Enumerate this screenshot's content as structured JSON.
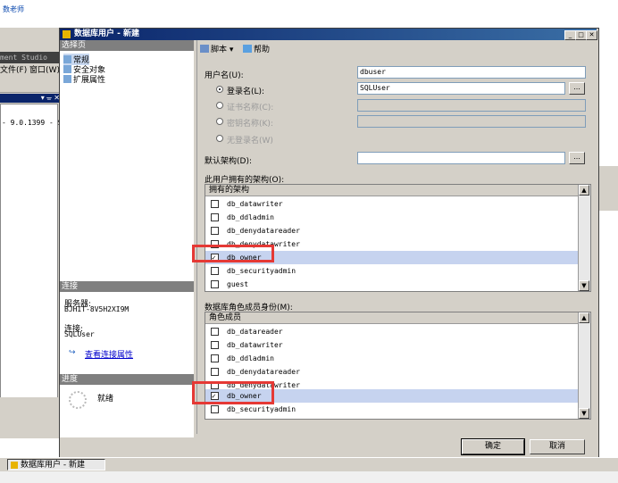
{
  "top": {
    "link": "数老师"
  },
  "bg": {
    "title": "ment Studio",
    "menu": "文件(F)  窗口(W)",
    "pane_btns": "▾ ᚚ ✕",
    "server_text": "- 9.0.1399 - S"
  },
  "dialog": {
    "title": "数据库用户 - 新建",
    "ctl_min": "_",
    "ctl_max": "□",
    "ctl_close": "✕"
  },
  "left": {
    "select_page_header": "选择页",
    "pages": [
      "常规",
      "安全对象",
      "扩展属性"
    ],
    "connection_header": "连接",
    "server_label": "服务器:",
    "server_value": "BJHIT-8V5H2XI9M",
    "conn_label": "连接:",
    "conn_value": "SQLUser",
    "view_conn_link": "查看连接属性",
    "progress_header": "进度",
    "progress_status": "就绪"
  },
  "toolbar": {
    "script": "脚本",
    "help": "帮助"
  },
  "form": {
    "username_label": "用户名(U):",
    "username_value": "dbuser",
    "login_radio": "登录名(L):",
    "login_value": "SQLUser",
    "cert_radio": "证书名称(C):",
    "key_radio": "密钥名称(K):",
    "nologin_radio": "无登录名(W)",
    "default_schema_label": "默认架构(D):",
    "default_schema_value": "",
    "ellipsis": "..."
  },
  "schemas": {
    "section_label": "此用户拥有的架构(O):",
    "column_header": "拥有的架构",
    "rows": [
      {
        "name": "db_datawriter",
        "checked": false
      },
      {
        "name": "db_ddladmin",
        "checked": false
      },
      {
        "name": "db_denydatareader",
        "checked": false
      },
      {
        "name": "db_denydatawriter",
        "checked": false
      },
      {
        "name": "db_owner",
        "checked": true
      },
      {
        "name": "db_securityadmin",
        "checked": false
      },
      {
        "name": "guest",
        "checked": false
      }
    ]
  },
  "roles": {
    "section_label": "数据库角色成员身份(M):",
    "column_header": "角色成员",
    "rows": [
      {
        "name": "db_datareader",
        "checked": false
      },
      {
        "name": "db_datawriter",
        "checked": false
      },
      {
        "name": "db_ddladmin",
        "checked": false
      },
      {
        "name": "db_denydatareader",
        "checked": false
      },
      {
        "name": "db_denydatawriter",
        "checked": false
      },
      {
        "name": "db_owner",
        "checked": true
      },
      {
        "name": "db_securityadmin",
        "checked": false
      }
    ]
  },
  "buttons": {
    "ok": "确定",
    "cancel": "取消"
  },
  "taskbar": {
    "item": "数据库用户 - 新建"
  },
  "colors": {
    "highlight_box": "#e53935",
    "title_bar": "#0a246a"
  }
}
